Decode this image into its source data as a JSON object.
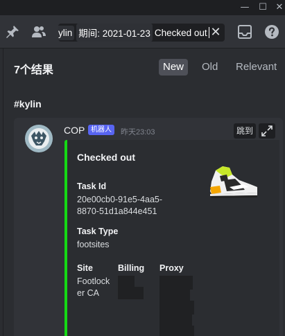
{
  "titlebar": {
    "minimize": "—",
    "maximize": "☐",
    "close": "✕"
  },
  "toolbar": {
    "search": {
      "chip_user": "ylin",
      "chip_date": "期间: 2021-01-23",
      "typed_text": "Checked out",
      "clear": "✕"
    }
  },
  "results": {
    "count_label": "7个结果",
    "sort_tabs": [
      {
        "label": "New",
        "active": true
      },
      {
        "label": "Old",
        "active": false
      },
      {
        "label": "Relevant",
        "active": false
      }
    ],
    "channel": "#kylin",
    "message": {
      "author": "COP",
      "bot_tag": "机器人",
      "timestamp": "昨天23:03",
      "jump_label": "跳到",
      "embed": {
        "accent_color": "#15d915",
        "title": "Checked out",
        "fields": [
          {
            "name": "Task Id",
            "value_lines": [
              "20e00cb0-91e5-4aa5-",
              "8870-51d1a844e451"
            ]
          },
          {
            "name": "Task Type",
            "value_lines": [
              "footsites"
            ]
          },
          {
            "name": "Site",
            "value_lines": [
              "Footlock",
              "er CA"
            ]
          },
          {
            "name": "Billing",
            "value_lines": []
          },
          {
            "name": "Proxy",
            "value_lines": []
          }
        ]
      }
    }
  }
}
